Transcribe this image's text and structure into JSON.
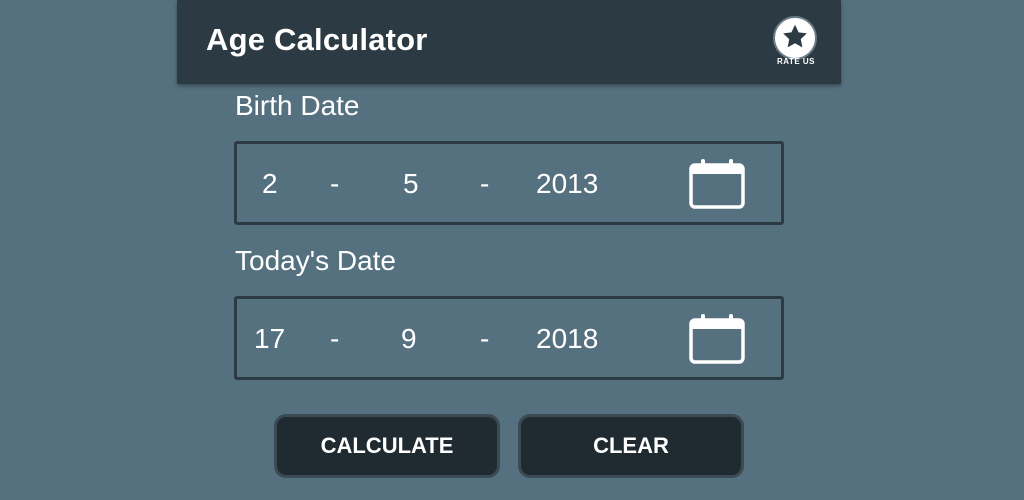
{
  "app": {
    "title": "Age Calculator",
    "rate_label": "RATE US",
    "rate_icon": "star-icon"
  },
  "birth": {
    "label": "Birth Date",
    "day": "2",
    "month": "5",
    "year": "2013",
    "separator": "-",
    "icon": "calendar-icon"
  },
  "today": {
    "label": "Today's Date",
    "day": "17",
    "month": "9",
    "year": "2018",
    "separator": "-",
    "icon": "calendar-icon"
  },
  "actions": {
    "calculate_label": "CALCULATE",
    "clear_label": "CLEAR"
  },
  "colors": {
    "background": "#55717f",
    "app_bar": "#2c3b43",
    "button": "#1f2b31",
    "text": "#ffffff"
  }
}
